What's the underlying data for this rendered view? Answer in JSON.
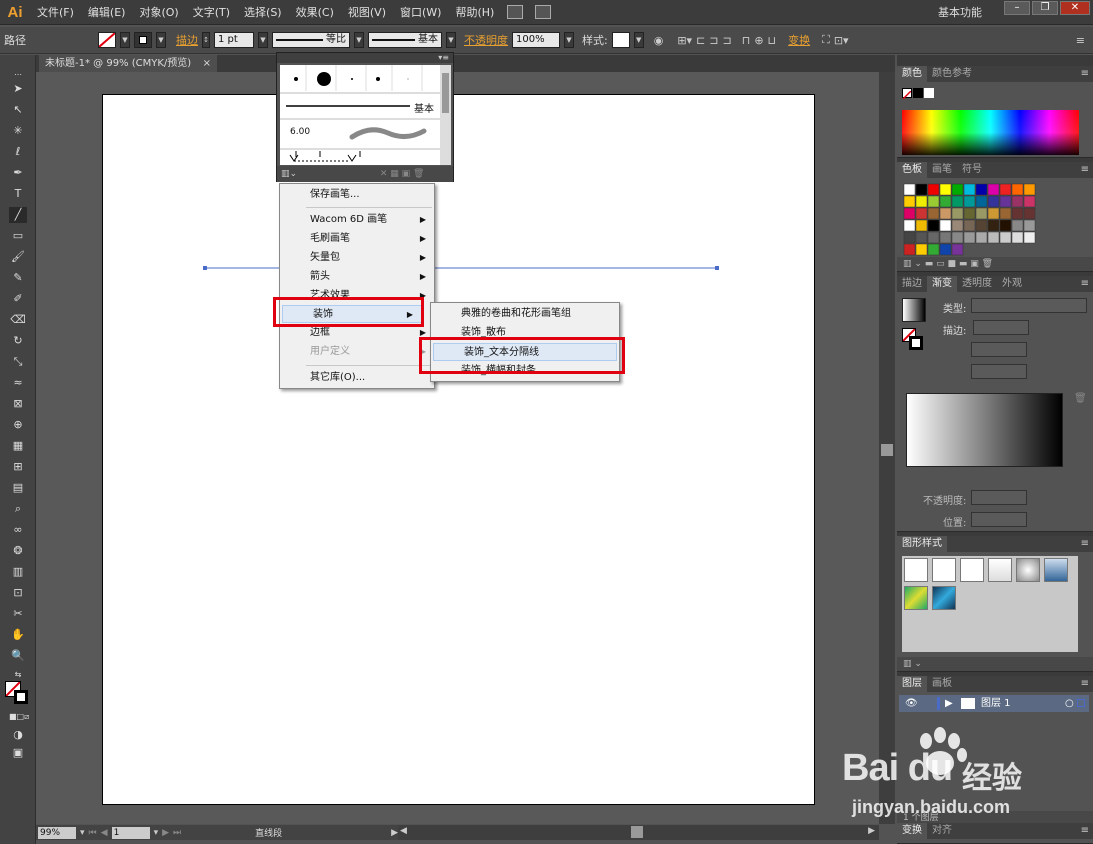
{
  "menubar": {
    "logo": "Ai",
    "items": [
      "文件(F)",
      "编辑(E)",
      "对象(O)",
      "文字(T)",
      "选择(S)",
      "效果(C)",
      "视图(V)",
      "窗口(W)",
      "帮助(H)"
    ],
    "workspace": "基本功能",
    "window_buttons": [
      "–",
      "❐",
      "✕"
    ]
  },
  "control_bar": {
    "selection_type": "路径",
    "stroke_link": "描边",
    "stroke_weight": "1 pt",
    "profile_label": "等比",
    "brush_label": "基本",
    "opacity_link": "不透明度",
    "opacity_value": "100%",
    "style_label": "样式:",
    "transform_link": "变换"
  },
  "document": {
    "tab_title": "未标题-1* @ 99% (CMYK/预览)",
    "tab_close": "×",
    "zoom": "99%",
    "artboard_nav": "1",
    "status": "直线段"
  },
  "brush_panel": {
    "basic_label": "基本",
    "brush_size": "6.00"
  },
  "brush_library_menu": {
    "items": [
      {
        "label": "保存画笔...",
        "submenu": false,
        "disabled": false
      },
      {
        "label": "Wacom 6D 画笔",
        "submenu": true,
        "disabled": false
      },
      {
        "label": "毛刷画笔",
        "submenu": true,
        "disabled": false
      },
      {
        "label": "矢量包",
        "submenu": true,
        "disabled": false
      },
      {
        "label": "箭头",
        "submenu": true,
        "disabled": false
      },
      {
        "label": "艺术效果",
        "submenu": true,
        "disabled": false
      },
      {
        "label": "装饰",
        "submenu": true,
        "disabled": false
      },
      {
        "label": "边框",
        "submenu": true,
        "disabled": false
      },
      {
        "label": "用户定义",
        "submenu": true,
        "disabled": true
      },
      {
        "label": "其它库(O)...",
        "submenu": false,
        "disabled": false
      }
    ]
  },
  "decoration_submenu": {
    "items": [
      "典雅的卷曲和花形画笔组",
      "装饰_散布",
      "装饰_文本分隔线",
      "装饰_横幅和封条"
    ]
  },
  "panels": {
    "color": {
      "tabs": [
        "颜色",
        "颜色参考"
      ]
    },
    "swatches": {
      "tabs": [
        "色板",
        "画笔",
        "符号"
      ]
    },
    "gradient": {
      "tabs": [
        "描边",
        "渐变",
        "透明度",
        "外观"
      ],
      "type_label": "类型:",
      "stroke_label": "描边:",
      "opacity_label": "不透明度:",
      "location_label": "位置:"
    },
    "graphic_styles": {
      "tabs": [
        "图形样式"
      ]
    },
    "layers": {
      "tabs": [
        "图层",
        "画板"
      ],
      "layer_name": "图层 1",
      "count": "1 个图层"
    },
    "transform": {
      "tabs": [
        "变换",
        "对齐"
      ]
    }
  },
  "watermark": {
    "logo": "Bai  du",
    "text": "经验",
    "url": "jingyan.baidu.com"
  },
  "colors": {
    "highlight_red": "#e00010",
    "line_blue": "#4a6cc8"
  }
}
